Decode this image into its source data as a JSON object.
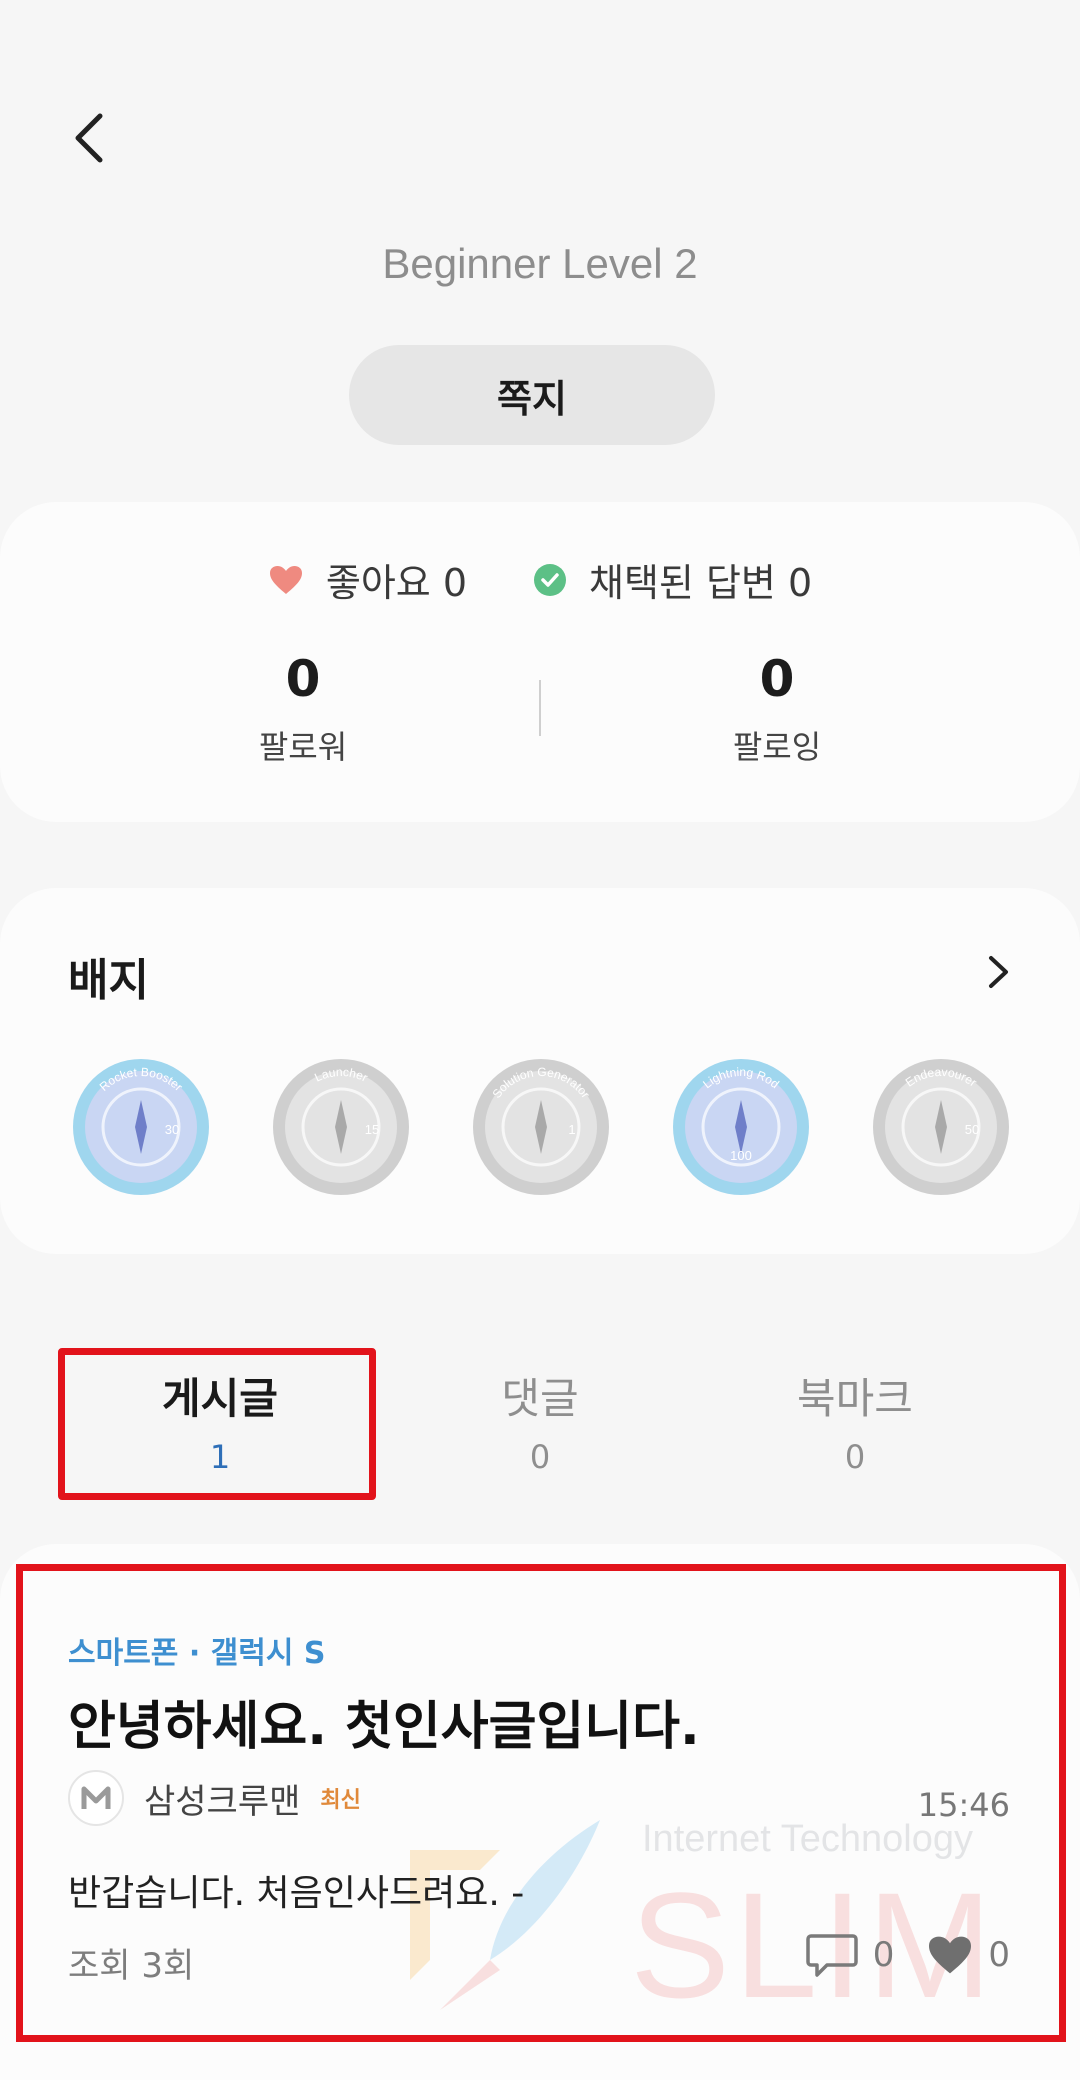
{
  "header": {
    "level": "Beginner Level 2",
    "message_button": "쪽지"
  },
  "stats": {
    "likes_label": "좋아요 0",
    "accepted_label": "채택된 답변 0",
    "followers": {
      "count": "0",
      "label": "팔로워"
    },
    "following": {
      "count": "0",
      "label": "팔로잉"
    }
  },
  "badges": {
    "title": "배지",
    "items": [
      {
        "name": "Rocket Booster",
        "number": "30",
        "color": "#c9d6f3",
        "ring": "#9fd6ee",
        "active": true
      },
      {
        "name": "Launcher",
        "number": "15",
        "color": "#e3e3e3",
        "ring": "#cfcfcf",
        "active": false
      },
      {
        "name": "Solution Generator",
        "number": "1",
        "color": "#e3e3e3",
        "ring": "#cfcfcf",
        "active": false
      },
      {
        "name": "Lightning Rod",
        "number": "100",
        "color": "#c9d6f3",
        "ring": "#9fd6ee",
        "active": true
      },
      {
        "name": "Endeavourer",
        "number": "50",
        "color": "#e3e3e3",
        "ring": "#cfcfcf",
        "active": false
      }
    ]
  },
  "tabs": [
    {
      "label": "게시글",
      "count": "1"
    },
    {
      "label": "댓글",
      "count": "0"
    },
    {
      "label": "북마크",
      "count": "0"
    }
  ],
  "post": {
    "category": "스마트폰 · 갤럭시 S",
    "title": "안녕하세요. 첫인사글입니다.",
    "author": "삼성크루맨",
    "author_badge": "최신",
    "time": "15:46",
    "body": "반갑습니다. 처음인사드려요. -",
    "views": "조회 3회",
    "comments": "0",
    "likes": "0"
  },
  "watermark": {
    "title": "Internet Technology",
    "text": "SLIM"
  },
  "colors": {
    "accent_blue": "#3e8fd0",
    "highlight_red": "#e2131b",
    "heart_pink": "#ef8a80",
    "check_green": "#5cc086"
  }
}
